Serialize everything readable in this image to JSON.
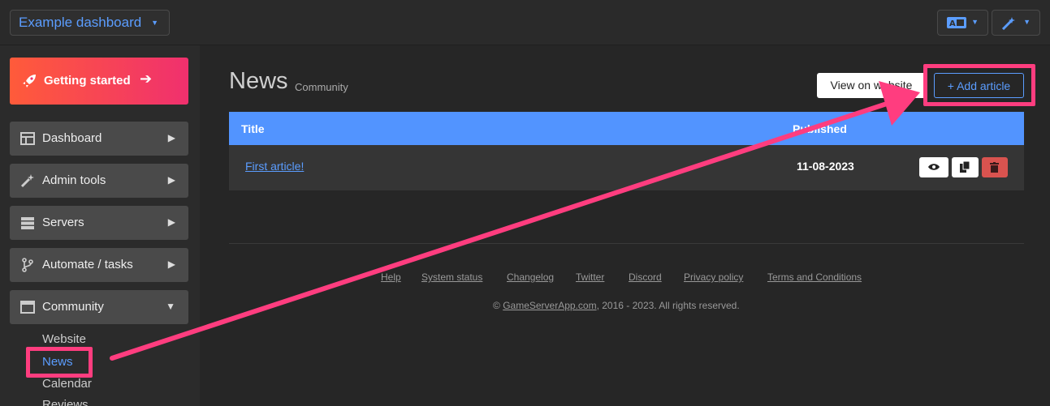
{
  "topbar": {
    "dashboard_select": "Example dashboard",
    "lang_button_icon": "translate-icon",
    "wand_button_icon": "magic-wand-icon"
  },
  "sidebar": {
    "getting_started": "Getting started",
    "items": [
      {
        "label": "Dashboard",
        "icon": "table-icon"
      },
      {
        "label": "Admin tools",
        "icon": "magic-wand-icon"
      },
      {
        "label": "Servers",
        "icon": "server-icon"
      },
      {
        "label": "Automate / tasks",
        "icon": "branch-icon"
      },
      {
        "label": "Community",
        "icon": "window-icon"
      }
    ],
    "community_sub": [
      "Website",
      "News",
      "Calendar",
      "Reviews"
    ],
    "active_sub": "News"
  },
  "page": {
    "title": "News",
    "subtitle": "Community",
    "view_button": "View on website",
    "add_button": "+ Add article"
  },
  "table": {
    "headers": [
      "Title",
      "Published"
    ],
    "rows": [
      {
        "title": "First article!",
        "published": "11-08-2023"
      }
    ]
  },
  "footer": {
    "links": [
      "Help",
      "System status",
      "Changelog",
      "Twitter",
      "Discord",
      "Privacy policy",
      "Terms and Conditions"
    ],
    "copyright_prefix": "© ",
    "copyright_link": "GameServerApp.com",
    "copyright_suffix": ", 2016 - 2023. All rights reserved."
  },
  "annotation": {
    "color": "#ff3d7f"
  },
  "colors": {
    "accent": "#5b9dff",
    "header_blue": "#5294ff",
    "delete_red": "#d9534f",
    "gradient_start": "#ff5b3a",
    "gradient_end": "#f0306e"
  }
}
